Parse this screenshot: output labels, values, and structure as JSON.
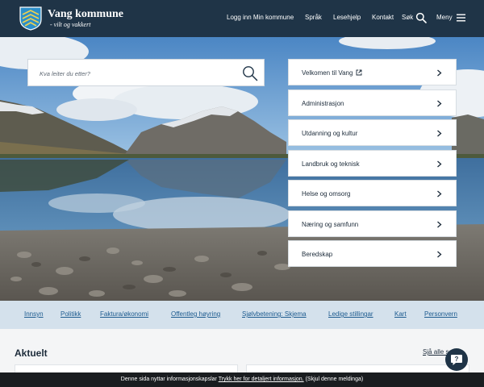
{
  "header": {
    "brand_name": "Vang kommune",
    "brand_tagline": "- vilt og vakkert",
    "nav": {
      "login": "Logg inn Min kommune",
      "language": "Språk",
      "reading_help": "Lesehjelp",
      "contact": "Kontakt",
      "search": "Søk",
      "menu": "Meny"
    },
    "icons": {
      "search": "search-icon",
      "menu": "hamburger-icon",
      "logo": "coat-of-arms"
    }
  },
  "search": {
    "placeholder": "Kva leiter du etter?",
    "value": ""
  },
  "quick_links": [
    {
      "label": "Velkomen til Vang",
      "external": true
    },
    {
      "label": "Administrasjon"
    },
    {
      "label": "Utdanning og kultur"
    },
    {
      "label": "Landbruk og teknisk"
    },
    {
      "label": "Helse og omsorg"
    },
    {
      "label": "Næring og samfunn"
    },
    {
      "label": "Beredskap"
    }
  ],
  "sub_nav": [
    "Innsyn",
    "Politikk",
    "Faktura/økonomi",
    "Offentleg høyring",
    "Sjølvbetening: Skjema",
    "Ledige stillingar",
    "Kart",
    "Personvern"
  ],
  "aktuelt": {
    "title": "Aktuelt",
    "see_all": "Sjå alle saker"
  },
  "chat": {
    "label": "?"
  },
  "cookie_bar": {
    "text_before": "Denne sida nyttar informasjonskapslar",
    "link_text": "Trykk her for detaljert informasjon.",
    "dismiss": "(Skjul denne meldinga)"
  },
  "colors": {
    "header_bg": "#1f3447",
    "subnav_bg": "#d4e1ec",
    "link_blue": "#1d5b8f",
    "cookie_bg": "#1a1d20"
  }
}
